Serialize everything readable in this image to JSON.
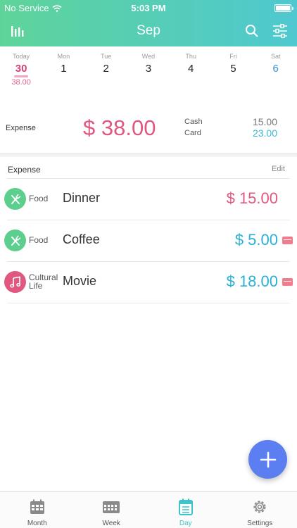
{
  "status_bar": {
    "carrier": "No Service",
    "time": "5:03 PM"
  },
  "navbar": {
    "title": "Sep"
  },
  "week": [
    {
      "name": "Today",
      "num": "30",
      "amount": "38.00"
    },
    {
      "name": "Mon",
      "num": "1"
    },
    {
      "name": "Tue",
      "num": "2"
    },
    {
      "name": "Wed",
      "num": "3"
    },
    {
      "name": "Thu",
      "num": "4"
    },
    {
      "name": "Fri",
      "num": "5"
    },
    {
      "name": "Sat",
      "num": "6"
    }
  ],
  "summary": {
    "label": "Expense",
    "total": "$ 38.00",
    "cash_label": "Cash",
    "cash_value": "15.00",
    "card_label": "Card",
    "card_value": "23.00"
  },
  "list": {
    "title": "Expense",
    "edit_label": "Edit",
    "items": [
      {
        "category": "Food",
        "name": "Dinner",
        "amount": "$ 15.00",
        "method": "cash",
        "icon": "fork-knife-icon",
        "color": "#5ccf8e"
      },
      {
        "category": "Food",
        "name": "Coffee",
        "amount": "$ 5.00",
        "method": "card",
        "icon": "fork-knife-icon",
        "color": "#5ccf8e"
      },
      {
        "category": "Cultural Life",
        "name": "Movie",
        "amount": "$ 18.00",
        "method": "card",
        "icon": "music-note-icon",
        "color": "#e0577f"
      }
    ]
  },
  "tabs": [
    {
      "label": "Month",
      "icon": "calendar-month-icon"
    },
    {
      "label": "Week",
      "icon": "calendar-week-icon"
    },
    {
      "label": "Day",
      "icon": "calendar-day-icon"
    },
    {
      "label": "Settings",
      "icon": "gear-icon"
    }
  ],
  "colors": {
    "accent": "#3fc4c9",
    "expense": "#e0577f",
    "card": "#2ab0d4",
    "fab": "#5b7ff0"
  }
}
